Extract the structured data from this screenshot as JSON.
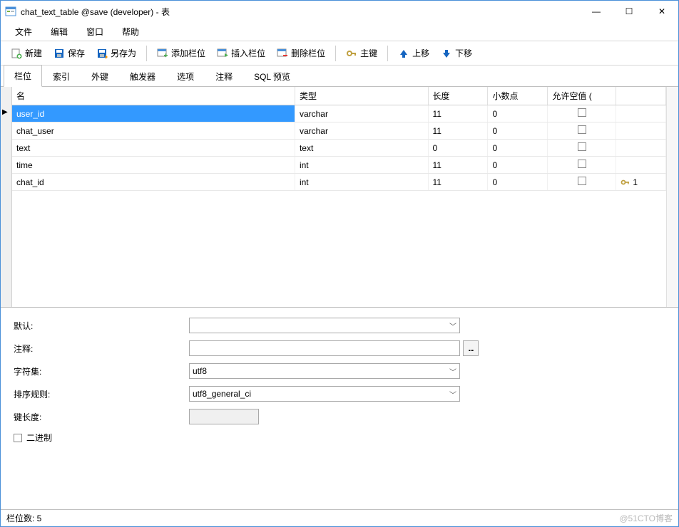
{
  "window": {
    "title": "chat_text_table @save (developer) - 表"
  },
  "winControls": {
    "min": "—",
    "max": "☐",
    "close": "✕"
  },
  "menu": {
    "file": "文件",
    "edit": "编辑",
    "window": "窗口",
    "help": "帮助"
  },
  "toolbar": {
    "new": "新建",
    "save": "保存",
    "saveAs": "另存为",
    "addField": "添加栏位",
    "insertField": "插入栏位",
    "deleteField": "删除栏位",
    "primaryKey": "主键",
    "moveUp": "上移",
    "moveDown": "下移"
  },
  "tabs": {
    "fields": "栏位",
    "indexes": "索引",
    "fk": "外键",
    "triggers": "触发器",
    "options": "选项",
    "comment": "注释",
    "sqlPreview": "SQL 预览"
  },
  "grid": {
    "headers": {
      "name": "名",
      "type": "类型",
      "length": "长度",
      "decimal": "小数点",
      "allowNull": "允许空值 (",
      "key": ""
    },
    "rows": [
      {
        "name": "user_id",
        "type": "varchar",
        "length": "11",
        "decimal": "0",
        "allowNull": false,
        "key": ""
      },
      {
        "name": "chat_user",
        "type": "varchar",
        "length": "11",
        "decimal": "0",
        "allowNull": false,
        "key": ""
      },
      {
        "name": "text",
        "type": "text",
        "length": "0",
        "decimal": "0",
        "allowNull": false,
        "key": ""
      },
      {
        "name": "time",
        "type": "int",
        "length": "11",
        "decimal": "0",
        "allowNull": false,
        "key": ""
      },
      {
        "name": "chat_id",
        "type": "int",
        "length": "11",
        "decimal": "0",
        "allowNull": false,
        "key": "1"
      }
    ]
  },
  "form": {
    "defaultLabel": "默认:",
    "defaultValue": "",
    "commentLabel": "注释:",
    "commentValue": "",
    "charsetLabel": "字符集:",
    "charsetValue": "utf8",
    "collationLabel": "排序规则:",
    "collationValue": "utf8_general_ci",
    "keyLengthLabel": "键长度:",
    "binaryLabel": "二进制",
    "ellipsis": "..."
  },
  "status": {
    "fieldCount": "栏位数: 5",
    "watermark": "@51CTO博客"
  },
  "icons": {
    "new": "#2e7d32",
    "save": "#1565c0",
    "saveAs": "#1565c0",
    "key": "#c0a040",
    "up": "#1565c0",
    "down": "#1565c0"
  }
}
